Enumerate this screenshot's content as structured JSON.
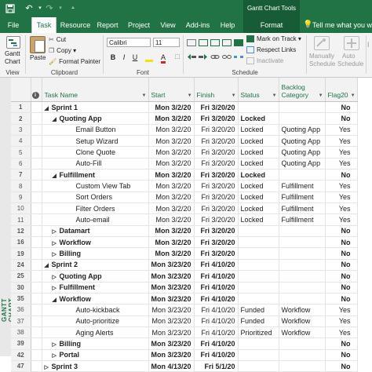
{
  "titlebar": {
    "save_icon": "save-icon",
    "undo_icon": "undo-icon",
    "redo_icon": "redo-icon",
    "context_title": "Gantt Chart Tools"
  },
  "tabs": [
    {
      "label": "File"
    },
    {
      "label": "Task"
    },
    {
      "label": "Resource"
    },
    {
      "label": "Report"
    },
    {
      "label": "Project"
    },
    {
      "label": "View"
    },
    {
      "label": "Add-ins"
    },
    {
      "label": "Help"
    },
    {
      "label": "Format"
    },
    {
      "label": "Tell me what you want"
    }
  ],
  "ribbon": {
    "view": {
      "button_line1": "Gantt",
      "button_line2": "Chart",
      "group": "View"
    },
    "clipboard": {
      "paste": "Paste",
      "cut": "Cut",
      "copy": "Copy",
      "format_painter": "Format Painter",
      "group": "Clipboard"
    },
    "font": {
      "family": "Calibri",
      "size": "11",
      "bold": "B",
      "italic": "I",
      "underline": "U",
      "group": "Font"
    },
    "schedule": {
      "mark_on_track": "Mark on Track",
      "respect_links": "Respect Links",
      "inactivate": "Inactivate",
      "group": "Schedule"
    },
    "tasks": {
      "manually_line1": "Manually",
      "manually_line2": "Schedule",
      "auto_line1": "Auto",
      "auto_line2": "Schedule"
    }
  },
  "side_label": "GANTT CHART",
  "columns": {
    "info": "i",
    "task_name": "Task Name",
    "start": "Start",
    "finish": "Finish",
    "status": "Status",
    "backlog_line1": "Backlog",
    "backlog_line2": "Category",
    "flag": "Flag20"
  },
  "rows": [
    {
      "id": "1",
      "name": "Sprint 1",
      "start": "Mon 3/2/20",
      "finish": "Fri 3/20/20",
      "status": "",
      "backlog": "",
      "flag": "No"
    },
    {
      "id": "2",
      "name": "Quoting App",
      "start": "Mon 3/2/20",
      "finish": "Fri 3/20/20",
      "status": "Locked",
      "backlog": "",
      "flag": "No"
    },
    {
      "id": "3",
      "name": "Email Button",
      "start": "Mon 3/2/20",
      "finish": "Fri 3/20/20",
      "status": "Locked",
      "backlog": "Quoting App",
      "flag": "Yes"
    },
    {
      "id": "4",
      "name": "Setup Wizard",
      "start": "Mon 3/2/20",
      "finish": "Fri 3/20/20",
      "status": "Locked",
      "backlog": "Quoting App",
      "flag": "Yes"
    },
    {
      "id": "5",
      "name": "Clone Quote",
      "start": "Mon 3/2/20",
      "finish": "Fri 3/20/20",
      "status": "Locked",
      "backlog": "Quoting App",
      "flag": "Yes"
    },
    {
      "id": "6",
      "name": "Auto-Fill",
      "start": "Mon 3/2/20",
      "finish": "Fri 3/20/20",
      "status": "Locked",
      "backlog": "Quoting App",
      "flag": "Yes"
    },
    {
      "id": "7",
      "name": "Fulfillment",
      "start": "Mon 3/2/20",
      "finish": "Fri 3/20/20",
      "status": "Locked",
      "backlog": "",
      "flag": "No"
    },
    {
      "id": "8",
      "name": "Custom View Tab",
      "start": "Mon 3/2/20",
      "finish": "Fri 3/20/20",
      "status": "Locked",
      "backlog": "Fulfillment",
      "flag": "Yes"
    },
    {
      "id": "9",
      "name": "Sort Orders",
      "start": "Mon 3/2/20",
      "finish": "Fri 3/20/20",
      "status": "Locked",
      "backlog": "Fulfillment",
      "flag": "Yes"
    },
    {
      "id": "10",
      "name": "Filter Orders",
      "start": "Mon 3/2/20",
      "finish": "Fri 3/20/20",
      "status": "Locked",
      "backlog": "Fulfillment",
      "flag": "Yes"
    },
    {
      "id": "11",
      "name": "Auto-email",
      "start": "Mon 3/2/20",
      "finish": "Fri 3/20/20",
      "status": "Locked",
      "backlog": "Fulfillment",
      "flag": "Yes"
    },
    {
      "id": "12",
      "name": "Datamart",
      "start": "Mon 3/2/20",
      "finish": "Fri 3/20/20",
      "status": "",
      "backlog": "",
      "flag": "No"
    },
    {
      "id": "16",
      "name": "Workflow",
      "start": "Mon 3/2/20",
      "finish": "Fri 3/20/20",
      "status": "",
      "backlog": "",
      "flag": "No"
    },
    {
      "id": "19",
      "name": "Billing",
      "start": "Mon 3/2/20",
      "finish": "Fri 3/20/20",
      "status": "",
      "backlog": "",
      "flag": "No"
    },
    {
      "id": "24",
      "name": "Sprint 2",
      "start": "Mon 3/23/20",
      "finish": "Fri 4/10/20",
      "status": "",
      "backlog": "",
      "flag": "No"
    },
    {
      "id": "25",
      "name": "Quoting App",
      "start": "Mon 3/23/20",
      "finish": "Fri 4/10/20",
      "status": "",
      "backlog": "",
      "flag": "No"
    },
    {
      "id": "30",
      "name": "Fulfillment",
      "start": "Mon 3/23/20",
      "finish": "Fri 4/10/20",
      "status": "",
      "backlog": "",
      "flag": "No"
    },
    {
      "id": "35",
      "name": "Workflow",
      "start": "Mon 3/23/20",
      "finish": "Fri 4/10/20",
      "status": "",
      "backlog": "",
      "flag": "No"
    },
    {
      "id": "36",
      "name": "Auto-kickback",
      "start": "Mon 3/23/20",
      "finish": "Fri 4/10/20",
      "status": "Funded",
      "backlog": "Workflow",
      "flag": "Yes"
    },
    {
      "id": "37",
      "name": "Auto-prioritize",
      "start": "Mon 3/23/20",
      "finish": "Fri 4/10/20",
      "status": "Funded",
      "backlog": "Workflow",
      "flag": "Yes"
    },
    {
      "id": "38",
      "name": "Aging Alerts",
      "start": "Mon 3/23/20",
      "finish": "Fri 4/10/20",
      "status": "Prioritized",
      "backlog": "Workflow",
      "flag": "Yes"
    },
    {
      "id": "39",
      "name": "Billing",
      "start": "Mon 3/23/20",
      "finish": "Fri 4/10/20",
      "status": "",
      "backlog": "",
      "flag": "No"
    },
    {
      "id": "42",
      "name": "Portal",
      "start": "Mon 3/23/20",
      "finish": "Fri 4/10/20",
      "status": "",
      "backlog": "",
      "flag": "No"
    },
    {
      "id": "47",
      "name": "Sprint 3",
      "start": "Mon 4/13/20",
      "finish": "Fri 5/1/20",
      "status": "",
      "backlog": "",
      "flag": "No"
    }
  ],
  "row_meta": [
    {
      "level": 0,
      "state": "expanded",
      "summary": true
    },
    {
      "level": 1,
      "state": "expanded",
      "summary": true
    },
    {
      "level": 2,
      "state": "leaf",
      "summary": false
    },
    {
      "level": 2,
      "state": "leaf",
      "summary": false
    },
    {
      "level": 2,
      "state": "leaf",
      "summary": false
    },
    {
      "level": 2,
      "state": "leaf",
      "summary": false
    },
    {
      "level": 1,
      "state": "expanded",
      "summary": true
    },
    {
      "level": 2,
      "state": "leaf",
      "summary": false
    },
    {
      "level": 2,
      "state": "leaf",
      "summary": false
    },
    {
      "level": 2,
      "state": "leaf",
      "summary": false
    },
    {
      "level": 2,
      "state": "leaf",
      "summary": false
    },
    {
      "level": 1,
      "state": "collapsed",
      "summary": true
    },
    {
      "level": 1,
      "state": "collapsed",
      "summary": true
    },
    {
      "level": 1,
      "state": "collapsed",
      "summary": true
    },
    {
      "level": 0,
      "state": "expanded",
      "summary": true
    },
    {
      "level": 1,
      "state": "collapsed",
      "summary": true
    },
    {
      "level": 1,
      "state": "collapsed",
      "summary": true
    },
    {
      "level": 1,
      "state": "expanded",
      "summary": true
    },
    {
      "level": 2,
      "state": "leaf",
      "summary": false
    },
    {
      "level": 2,
      "state": "leaf",
      "summary": false
    },
    {
      "level": 2,
      "state": "leaf",
      "summary": false
    },
    {
      "level": 1,
      "state": "collapsed",
      "summary": true
    },
    {
      "level": 1,
      "state": "collapsed",
      "summary": true
    },
    {
      "level": 0,
      "state": "collapsed",
      "summary": true
    }
  ],
  "colors": {
    "accent": "#217346",
    "accent_dark": "#185c37"
  }
}
